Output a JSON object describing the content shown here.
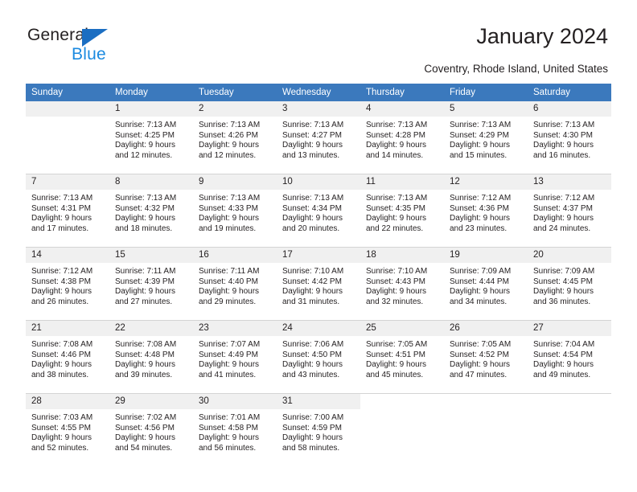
{
  "brand": {
    "name_part1": "General",
    "name_part2": "Blue",
    "triangle_icon": "triangle-icon",
    "color_dark": "#231f20",
    "color_blue": "#1b8ae0",
    "accent": "#1b6ec2"
  },
  "header": {
    "title": "January 2024",
    "subtitle": "Coventry, Rhode Island, United States",
    "header_bg": "#3b79bd",
    "daynum_bg": "#f0f0f0"
  },
  "weekday_headers": [
    "Sunday",
    "Monday",
    "Tuesday",
    "Wednesday",
    "Thursday",
    "Friday",
    "Saturday"
  ],
  "weeks": [
    [
      {
        "day": "",
        "sunrise": "",
        "sunset": "",
        "daylight1": "",
        "daylight2": "",
        "empty": true
      },
      {
        "day": "1",
        "sunrise": "Sunrise: 7:13 AM",
        "sunset": "Sunset: 4:25 PM",
        "daylight1": "Daylight: 9 hours",
        "daylight2": "and 12 minutes."
      },
      {
        "day": "2",
        "sunrise": "Sunrise: 7:13 AM",
        "sunset": "Sunset: 4:26 PM",
        "daylight1": "Daylight: 9 hours",
        "daylight2": "and 12 minutes."
      },
      {
        "day": "3",
        "sunrise": "Sunrise: 7:13 AM",
        "sunset": "Sunset: 4:27 PM",
        "daylight1": "Daylight: 9 hours",
        "daylight2": "and 13 minutes."
      },
      {
        "day": "4",
        "sunrise": "Sunrise: 7:13 AM",
        "sunset": "Sunset: 4:28 PM",
        "daylight1": "Daylight: 9 hours",
        "daylight2": "and 14 minutes."
      },
      {
        "day": "5",
        "sunrise": "Sunrise: 7:13 AM",
        "sunset": "Sunset: 4:29 PM",
        "daylight1": "Daylight: 9 hours",
        "daylight2": "and 15 minutes."
      },
      {
        "day": "6",
        "sunrise": "Sunrise: 7:13 AM",
        "sunset": "Sunset: 4:30 PM",
        "daylight1": "Daylight: 9 hours",
        "daylight2": "and 16 minutes."
      }
    ],
    [
      {
        "day": "7",
        "sunrise": "Sunrise: 7:13 AM",
        "sunset": "Sunset: 4:31 PM",
        "daylight1": "Daylight: 9 hours",
        "daylight2": "and 17 minutes."
      },
      {
        "day": "8",
        "sunrise": "Sunrise: 7:13 AM",
        "sunset": "Sunset: 4:32 PM",
        "daylight1": "Daylight: 9 hours",
        "daylight2": "and 18 minutes."
      },
      {
        "day": "9",
        "sunrise": "Sunrise: 7:13 AM",
        "sunset": "Sunset: 4:33 PM",
        "daylight1": "Daylight: 9 hours",
        "daylight2": "and 19 minutes."
      },
      {
        "day": "10",
        "sunrise": "Sunrise: 7:13 AM",
        "sunset": "Sunset: 4:34 PM",
        "daylight1": "Daylight: 9 hours",
        "daylight2": "and 20 minutes."
      },
      {
        "day": "11",
        "sunrise": "Sunrise: 7:13 AM",
        "sunset": "Sunset: 4:35 PM",
        "daylight1": "Daylight: 9 hours",
        "daylight2": "and 22 minutes."
      },
      {
        "day": "12",
        "sunrise": "Sunrise: 7:12 AM",
        "sunset": "Sunset: 4:36 PM",
        "daylight1": "Daylight: 9 hours",
        "daylight2": "and 23 minutes."
      },
      {
        "day": "13",
        "sunrise": "Sunrise: 7:12 AM",
        "sunset": "Sunset: 4:37 PM",
        "daylight1": "Daylight: 9 hours",
        "daylight2": "and 24 minutes."
      }
    ],
    [
      {
        "day": "14",
        "sunrise": "Sunrise: 7:12 AM",
        "sunset": "Sunset: 4:38 PM",
        "daylight1": "Daylight: 9 hours",
        "daylight2": "and 26 minutes."
      },
      {
        "day": "15",
        "sunrise": "Sunrise: 7:11 AM",
        "sunset": "Sunset: 4:39 PM",
        "daylight1": "Daylight: 9 hours",
        "daylight2": "and 27 minutes."
      },
      {
        "day": "16",
        "sunrise": "Sunrise: 7:11 AM",
        "sunset": "Sunset: 4:40 PM",
        "daylight1": "Daylight: 9 hours",
        "daylight2": "and 29 minutes."
      },
      {
        "day": "17",
        "sunrise": "Sunrise: 7:10 AM",
        "sunset": "Sunset: 4:42 PM",
        "daylight1": "Daylight: 9 hours",
        "daylight2": "and 31 minutes."
      },
      {
        "day": "18",
        "sunrise": "Sunrise: 7:10 AM",
        "sunset": "Sunset: 4:43 PM",
        "daylight1": "Daylight: 9 hours",
        "daylight2": "and 32 minutes."
      },
      {
        "day": "19",
        "sunrise": "Sunrise: 7:09 AM",
        "sunset": "Sunset: 4:44 PM",
        "daylight1": "Daylight: 9 hours",
        "daylight2": "and 34 minutes."
      },
      {
        "day": "20",
        "sunrise": "Sunrise: 7:09 AM",
        "sunset": "Sunset: 4:45 PM",
        "daylight1": "Daylight: 9 hours",
        "daylight2": "and 36 minutes."
      }
    ],
    [
      {
        "day": "21",
        "sunrise": "Sunrise: 7:08 AM",
        "sunset": "Sunset: 4:46 PM",
        "daylight1": "Daylight: 9 hours",
        "daylight2": "and 38 minutes."
      },
      {
        "day": "22",
        "sunrise": "Sunrise: 7:08 AM",
        "sunset": "Sunset: 4:48 PM",
        "daylight1": "Daylight: 9 hours",
        "daylight2": "and 39 minutes."
      },
      {
        "day": "23",
        "sunrise": "Sunrise: 7:07 AM",
        "sunset": "Sunset: 4:49 PM",
        "daylight1": "Daylight: 9 hours",
        "daylight2": "and 41 minutes."
      },
      {
        "day": "24",
        "sunrise": "Sunrise: 7:06 AM",
        "sunset": "Sunset: 4:50 PM",
        "daylight1": "Daylight: 9 hours",
        "daylight2": "and 43 minutes."
      },
      {
        "day": "25",
        "sunrise": "Sunrise: 7:05 AM",
        "sunset": "Sunset: 4:51 PM",
        "daylight1": "Daylight: 9 hours",
        "daylight2": "and 45 minutes."
      },
      {
        "day": "26",
        "sunrise": "Sunrise: 7:05 AM",
        "sunset": "Sunset: 4:52 PM",
        "daylight1": "Daylight: 9 hours",
        "daylight2": "and 47 minutes."
      },
      {
        "day": "27",
        "sunrise": "Sunrise: 7:04 AM",
        "sunset": "Sunset: 4:54 PM",
        "daylight1": "Daylight: 9 hours",
        "daylight2": "and 49 minutes."
      }
    ],
    [
      {
        "day": "28",
        "sunrise": "Sunrise: 7:03 AM",
        "sunset": "Sunset: 4:55 PM",
        "daylight1": "Daylight: 9 hours",
        "daylight2": "and 52 minutes."
      },
      {
        "day": "29",
        "sunrise": "Sunrise: 7:02 AM",
        "sunset": "Sunset: 4:56 PM",
        "daylight1": "Daylight: 9 hours",
        "daylight2": "and 54 minutes."
      },
      {
        "day": "30",
        "sunrise": "Sunrise: 7:01 AM",
        "sunset": "Sunset: 4:58 PM",
        "daylight1": "Daylight: 9 hours",
        "daylight2": "and 56 minutes."
      },
      {
        "day": "31",
        "sunrise": "Sunrise: 7:00 AM",
        "sunset": "Sunset: 4:59 PM",
        "daylight1": "Daylight: 9 hours",
        "daylight2": "and 58 minutes."
      },
      {
        "day": "",
        "sunrise": "",
        "sunset": "",
        "daylight1": "",
        "daylight2": "",
        "blank": true
      },
      {
        "day": "",
        "sunrise": "",
        "sunset": "",
        "daylight1": "",
        "daylight2": "",
        "blank": true
      },
      {
        "day": "",
        "sunrise": "",
        "sunset": "",
        "daylight1": "",
        "daylight2": "",
        "blank": true
      }
    ]
  ]
}
